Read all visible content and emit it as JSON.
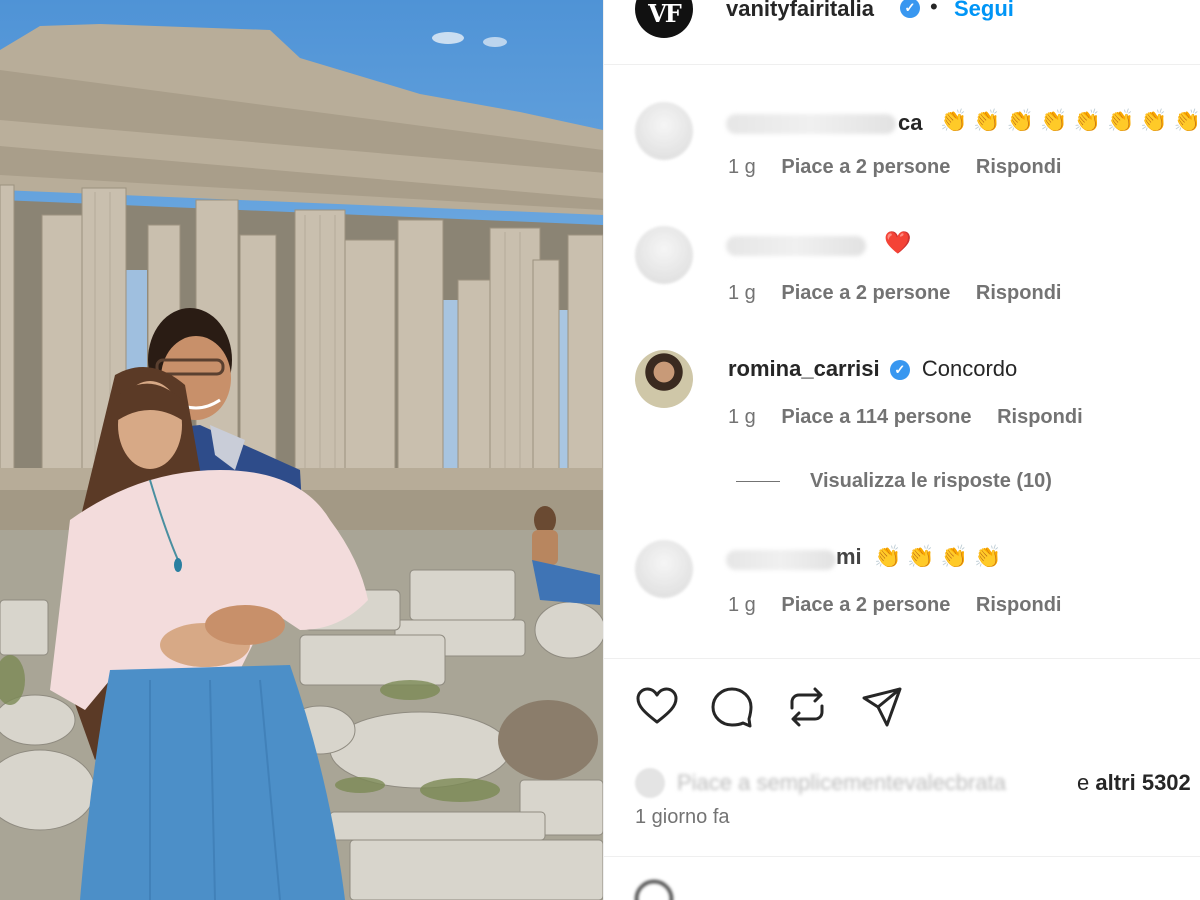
{
  "header": {
    "avatar_text": "VF",
    "username": "vanityfairitalia",
    "separator": "•",
    "follow_label": "Segui"
  },
  "comments": [
    {
      "name_visible": "ca",
      "text": "👏👏👏👏👏👏👏👏",
      "time": "1 g",
      "likes": "Piace a 2 persone",
      "reply": "Rispondi"
    },
    {
      "name_visible": "",
      "text": "❤️",
      "time": "1 g",
      "likes": "Piace a 2 persone",
      "reply": "Rispondi"
    },
    {
      "name": "romina_carrisi",
      "text": "Concordo",
      "time": "1 g",
      "likes": "Piace a 114 persone",
      "reply": "Rispondi",
      "view_replies": "Visualizza le risposte (10)"
    },
    {
      "name_visible": "mi",
      "text": "👏👏👏👏",
      "time": "1 g",
      "likes": "Piace a 2 persone",
      "reply": "Rispondi"
    }
  ],
  "actions": {
    "like_icon": "heart-icon",
    "comment_icon": "comment-icon",
    "repost_icon": "repost-icon",
    "share_icon": "share-icon"
  },
  "likes_summary": {
    "blurred_prefix": "Piace a semplicementevalecbrata",
    "conjunction": "e",
    "others": "altri 5302"
  },
  "post_time": "1 giorno fa",
  "colors": {
    "link_blue": "#0095f6",
    "verified_blue": "#3897f0",
    "secondary_text": "#737373",
    "heart_red": "#ed4956"
  }
}
